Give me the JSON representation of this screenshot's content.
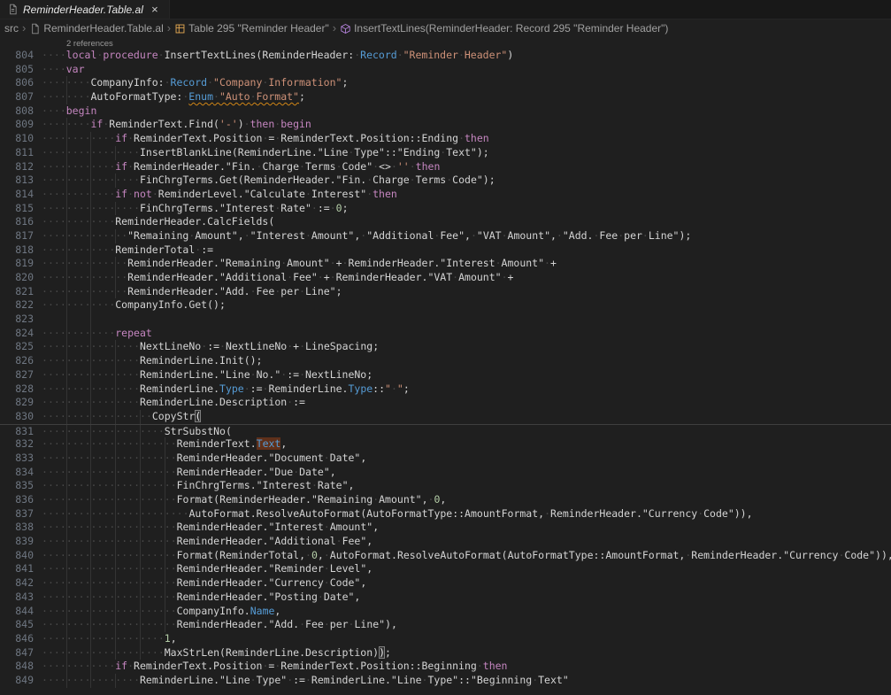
{
  "colors": {
    "editor_bg": "#1f1f1f",
    "keyword": "#C586C0",
    "type": "#569CD6",
    "string": "#CE9178",
    "number": "#B5CEA8",
    "plain": "#d4d4d4",
    "linenum": "#6e7681",
    "squiggle": "#D18616",
    "find_bg": "#5F301A",
    "table_icon": "#E8AB53",
    "method_icon": "#B180D7",
    "file_icon": "#8f8f8f"
  },
  "tab_bar": {
    "tabs": [
      {
        "label": "ReminderHeader.Table.al",
        "active": true,
        "preview": true,
        "icon": "al-file-icon",
        "close_glyph": "×"
      }
    ]
  },
  "breadcrumbs": {
    "separator": "›",
    "items": [
      {
        "label": "src",
        "icon": null
      },
      {
        "label": "ReminderHeader.Table.al",
        "icon": "file-icon"
      },
      {
        "label": "Table 295 \"Reminder Header\"",
        "icon": "table-symbol-icon"
      },
      {
        "label": "InsertTextLines(ReminderHeader: Record 295 \"Reminder Header\")",
        "icon": "method-symbol-icon"
      }
    ]
  },
  "editor": {
    "codelens": "2 references",
    "lines": [
      {
        "n": 804,
        "tokens": [
          [
            "p",
            "    "
          ],
          [
            "k",
            "local"
          ],
          [
            "p",
            " "
          ],
          [
            "k",
            "procedure"
          ],
          [
            "p",
            " InsertTextLines(ReminderHeader: "
          ],
          [
            "t",
            "Record"
          ],
          [
            "p",
            " "
          ],
          [
            "s",
            "\"Reminder Header\""
          ],
          [
            "p",
            ")"
          ]
        ]
      },
      {
        "n": 805,
        "tokens": [
          [
            "p",
            "    "
          ],
          [
            "k",
            "var"
          ]
        ]
      },
      {
        "n": 806,
        "tokens": [
          [
            "p",
            "        CompanyInfo: "
          ],
          [
            "t",
            "Record"
          ],
          [
            "p",
            " "
          ],
          [
            "s",
            "\"Company Information\""
          ],
          [
            "p",
            ";"
          ]
        ]
      },
      {
        "n": 807,
        "tokens": [
          [
            "p",
            "        AutoFormatType: "
          ],
          [
            "t sq",
            "Enum"
          ],
          [
            "p sq",
            " "
          ],
          [
            "s sq",
            "\"Auto Format\""
          ],
          [
            "p",
            ";"
          ]
        ]
      },
      {
        "n": 808,
        "tokens": [
          [
            "p",
            "    "
          ],
          [
            "k",
            "begin"
          ]
        ]
      },
      {
        "n": 809,
        "tokens": [
          [
            "p",
            "        "
          ],
          [
            "k",
            "if"
          ],
          [
            "p",
            " ReminderText.Find("
          ],
          [
            "s",
            "'-'"
          ],
          [
            "p",
            ") "
          ],
          [
            "k",
            "then"
          ],
          [
            "p",
            " "
          ],
          [
            "k",
            "begin"
          ]
        ]
      },
      {
        "n": 810,
        "tokens": [
          [
            "p",
            "            "
          ],
          [
            "k",
            "if"
          ],
          [
            "p",
            " ReminderText.Position = ReminderText.Position::Ending "
          ],
          [
            "k",
            "then"
          ]
        ]
      },
      {
        "n": 811,
        "tokens": [
          [
            "p",
            "                InsertBlankLine(ReminderLine.\"Line Type\"::\"Ending Text\");"
          ]
        ]
      },
      {
        "n": 812,
        "tokens": [
          [
            "p",
            "            "
          ],
          [
            "k",
            "if"
          ],
          [
            "p",
            " ReminderHeader.\"Fin. Charge Terms Code\" <> "
          ],
          [
            "s",
            "''"
          ],
          [
            "p",
            " "
          ],
          [
            "k",
            "then"
          ]
        ]
      },
      {
        "n": 813,
        "tokens": [
          [
            "p",
            "                FinChrgTerms.Get(ReminderHeader.\"Fin. Charge Terms Code\");"
          ]
        ]
      },
      {
        "n": 814,
        "tokens": [
          [
            "p",
            "            "
          ],
          [
            "k",
            "if"
          ],
          [
            "p",
            " "
          ],
          [
            "k",
            "not"
          ],
          [
            "p",
            " ReminderLevel.\"Calculate Interest\" "
          ],
          [
            "k",
            "then"
          ]
        ]
      },
      {
        "n": 815,
        "tokens": [
          [
            "p",
            "                FinChrgTerms.\"Interest Rate\" := "
          ],
          [
            "n",
            "0"
          ],
          [
            "p",
            ";"
          ]
        ]
      },
      {
        "n": 816,
        "tokens": [
          [
            "p",
            "            ReminderHeader.CalcFields("
          ]
        ]
      },
      {
        "n": 817,
        "tokens": [
          [
            "p",
            "              \"Remaining Amount\", \"Interest Amount\", \"Additional Fee\", \"VAT Amount\", \"Add. Fee per Line\");"
          ]
        ]
      },
      {
        "n": 818,
        "tokens": [
          [
            "p",
            "            ReminderTotal :="
          ]
        ]
      },
      {
        "n": 819,
        "tokens": [
          [
            "p",
            "              ReminderHeader.\"Remaining Amount\" + ReminderHeader.\"Interest Amount\" +"
          ]
        ]
      },
      {
        "n": 820,
        "tokens": [
          [
            "p",
            "              ReminderHeader.\"Additional Fee\" + ReminderHeader.\"VAT Amount\" +"
          ]
        ]
      },
      {
        "n": 821,
        "tokens": [
          [
            "p",
            "              ReminderHeader.\"Add. Fee per Line\";"
          ]
        ]
      },
      {
        "n": 822,
        "tokens": [
          [
            "p",
            "            CompanyInfo.Get();"
          ]
        ]
      },
      {
        "n": 823,
        "tokens": []
      },
      {
        "n": 824,
        "tokens": [
          [
            "p",
            "            "
          ],
          [
            "k",
            "repeat"
          ]
        ]
      },
      {
        "n": 825,
        "tokens": [
          [
            "p",
            "                NextLineNo := NextLineNo + LineSpacing;"
          ]
        ]
      },
      {
        "n": 826,
        "tokens": [
          [
            "p",
            "                ReminderLine.Init();"
          ]
        ]
      },
      {
        "n": 827,
        "tokens": [
          [
            "p",
            "                ReminderLine.\"Line No.\" := NextLineNo;"
          ]
        ]
      },
      {
        "n": 828,
        "tokens": [
          [
            "p",
            "                ReminderLine."
          ],
          [
            "t",
            "Type"
          ],
          [
            "p",
            " := ReminderLine."
          ],
          [
            "t",
            "Type"
          ],
          [
            "p",
            "::"
          ],
          [
            "s",
            "\" \""
          ],
          [
            "p",
            ";"
          ]
        ]
      },
      {
        "n": 829,
        "tokens": [
          [
            "p",
            "                ReminderLine.Description :="
          ]
        ]
      },
      {
        "n": 830,
        "tokens": [
          [
            "p",
            "                  CopyStr"
          ],
          [
            "p bm",
            "("
          ]
        ]
      },
      {
        "n": 831,
        "rule_top": true,
        "tokens": [
          [
            "p",
            "                    StrSubstNo("
          ]
        ]
      },
      {
        "n": 832,
        "tokens": [
          [
            "p",
            "                      ReminderText."
          ],
          [
            "t find",
            "Text"
          ],
          [
            "p",
            ","
          ]
        ]
      },
      {
        "n": 833,
        "tokens": [
          [
            "p",
            "                      ReminderHeader.\"Document Date\","
          ]
        ]
      },
      {
        "n": 834,
        "tokens": [
          [
            "p",
            "                      ReminderHeader.\"Due Date\","
          ]
        ]
      },
      {
        "n": 835,
        "tokens": [
          [
            "p",
            "                      FinChrgTerms.\"Interest Rate\","
          ]
        ]
      },
      {
        "n": 836,
        "tokens": [
          [
            "p",
            "                      Format(ReminderHeader.\"Remaining Amount\", "
          ],
          [
            "n",
            "0"
          ],
          [
            "p",
            ","
          ]
        ]
      },
      {
        "n": 837,
        "tokens": [
          [
            "p",
            "                        AutoFormat.ResolveAutoFormat(AutoFormatType::AmountFormat, ReminderHeader.\"Currency Code\")),"
          ]
        ]
      },
      {
        "n": 838,
        "tokens": [
          [
            "p",
            "                      ReminderHeader.\"Interest Amount\","
          ]
        ]
      },
      {
        "n": 839,
        "tokens": [
          [
            "p",
            "                      ReminderHeader.\"Additional Fee\","
          ]
        ]
      },
      {
        "n": 840,
        "tokens": [
          [
            "p",
            "                      Format(ReminderTotal, "
          ],
          [
            "n",
            "0"
          ],
          [
            "p",
            ", AutoFormat.ResolveAutoFormat(AutoFormatType::AmountFormat, ReminderHeader.\"Currency Code\")),"
          ]
        ]
      },
      {
        "n": 841,
        "tokens": [
          [
            "p",
            "                      ReminderHeader.\"Reminder Level\","
          ]
        ]
      },
      {
        "n": 842,
        "tokens": [
          [
            "p",
            "                      ReminderHeader.\"Currency Code\","
          ]
        ]
      },
      {
        "n": 843,
        "tokens": [
          [
            "p",
            "                      ReminderHeader.\"Posting Date\","
          ]
        ]
      },
      {
        "n": 844,
        "tokens": [
          [
            "p",
            "                      CompanyInfo."
          ],
          [
            "t",
            "Name"
          ],
          [
            "p",
            ","
          ]
        ]
      },
      {
        "n": 845,
        "tokens": [
          [
            "p",
            "                      ReminderHeader.\"Add. Fee per Line\"),"
          ]
        ]
      },
      {
        "n": 846,
        "tokens": [
          [
            "p",
            "                    "
          ],
          [
            "n",
            "1"
          ],
          [
            "p",
            ","
          ]
        ]
      },
      {
        "n": 847,
        "tokens": [
          [
            "p",
            "                    MaxStrLen(ReminderLine.Description)"
          ],
          [
            "p bm",
            ")"
          ],
          [
            "p",
            ";"
          ]
        ]
      },
      {
        "n": 848,
        "tokens": [
          [
            "p",
            "            "
          ],
          [
            "k",
            "if"
          ],
          [
            "p",
            " ReminderText.Position = ReminderText.Position::Beginning "
          ],
          [
            "k",
            "then"
          ]
        ]
      },
      {
        "n": 849,
        "tokens": [
          [
            "p",
            "                ReminderLine.\"Line Type\" := ReminderLine.\"Line Type\"::\"Beginning Text\""
          ]
        ]
      }
    ]
  }
}
